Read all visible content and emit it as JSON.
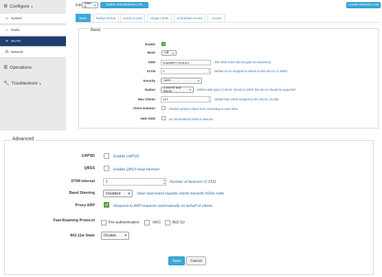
{
  "sidebar": {
    "configure": "Configure",
    "items": [
      {
        "label": "System",
        "icon": "monitor-icon"
      },
      {
        "label": "Radio",
        "icon": "radio-icon"
      },
      {
        "label": "WLAN",
        "icon": "wifi-icon"
      },
      {
        "label": "Network",
        "icon": "network-icon"
      }
    ],
    "operations": "Operations",
    "troubleshoot": "Troubleshoot"
  },
  "toolbar": {
    "edit_label": "Edit",
    "wlan_select": "wlan 5",
    "delete_button": "Delete this Wireless LAN",
    "create_button": "Create Wireless LAN"
  },
  "tabs": [
    {
      "label": "Basic",
      "active": true
    },
    {
      "label": "Radius Server",
      "active": false
    },
    {
      "label": "Guest Access",
      "active": false
    },
    {
      "label": "Usage Limits",
      "active": false
    },
    {
      "label": "Scheduled Access",
      "active": false
    },
    {
      "label": "Access",
      "active": false
    }
  ],
  "basic": {
    "legend": "Basic",
    "enable": {
      "label": "Enable",
      "checked": true
    },
    "mesh": {
      "label": "Mesh",
      "value": "Off"
    },
    "ssid": {
      "label": "SSID",
      "value": "DataWiFi-Centrum",
      "help": "The SSID of this WLAN (upto 32 characters)"
    },
    "vlan": {
      "label": "VLAN",
      "value": "1",
      "help": "Default VLAN assigned to clients on this WLAN. (1-4094)"
    },
    "security": {
      "label": "Security",
      "value": "open"
    },
    "radios": {
      "label": "Radios",
      "value": "2.4GHz and 5GHz",
      "help": "Define radio types (2.4GHz, 5GHz) on which this WLAN should be supported"
    },
    "max_clients": {
      "label": "Max Clients",
      "value": "127",
      "help": "Default Max Client assigned to this WLAN. (0-255)"
    },
    "client_isolation": {
      "label": "Client Isolation",
      "checked": false,
      "help": "Prevent wireless clients from connecting to each other"
    },
    "hide_ssid": {
      "label": "Hide SSID",
      "checked": false,
      "help": "Do not broadcast SSID in beacons"
    }
  },
  "advanced": {
    "legend": "Advanced",
    "uapsd": {
      "label": "UAPSD",
      "checked": false,
      "help": "Enable UAPSD"
    },
    "qbss": {
      "label": "QBSS",
      "checked": false,
      "help": "Enable QBSS load element"
    },
    "dtim": {
      "label": "DTIM interval",
      "value": "1",
      "help": "Number of beacons (1-255)"
    },
    "band_steering": {
      "label": "Band Steering",
      "value": "Disabled",
      "help": "Steer dual-band capable clients towards 5GHz radio"
    },
    "proxy_arp": {
      "label": "Proxy ARP",
      "checked": true,
      "help": "Respond to ARP requests automatically on behalf of clients"
    },
    "fast_roaming": {
      "label": "Fast-Roaming Protocol",
      "options": [
        {
          "label": "Pre-authentication",
          "checked": false
        },
        {
          "label": "OKC",
          "checked": false
        },
        {
          "label": "802.11r",
          "checked": false
        }
      ]
    },
    "dot11w": {
      "label": "802.11w State",
      "value": "Disable"
    }
  },
  "actions": {
    "save": "Save",
    "cancel": "Cancel"
  },
  "colors": {
    "accent": "#3aa8d8",
    "sidebar_active": "#1d3f6f",
    "checkbox_on": "#6aa84f"
  }
}
